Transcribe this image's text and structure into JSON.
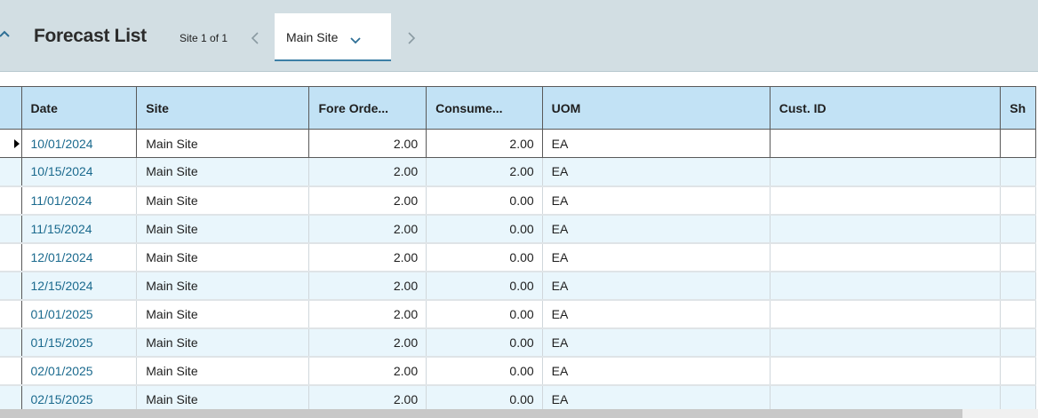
{
  "header": {
    "title": "Forecast List",
    "site_counter": "Site 1 of 1",
    "selected_site": "Main Site",
    "icons": {
      "collapse": "chevron-up-icon",
      "prev": "chevron-left-icon",
      "next": "chevron-right-icon",
      "dropdown": "chevron-down-icon"
    }
  },
  "grid": {
    "columns": [
      "Date",
      "Site",
      "Fore Orde...",
      "Consume...",
      "UOM",
      "Cust. ID",
      "Sh"
    ],
    "rows": [
      {
        "date": "10/01/2024",
        "site": "Main Site",
        "fore": "2.00",
        "consumed": "2.00",
        "uom": "EA",
        "cust": "",
        "sh": ""
      },
      {
        "date": "10/15/2024",
        "site": "Main Site",
        "fore": "2.00",
        "consumed": "2.00",
        "uom": "EA",
        "cust": "",
        "sh": ""
      },
      {
        "date": "11/01/2024",
        "site": "Main Site",
        "fore": "2.00",
        "consumed": "0.00",
        "uom": "EA",
        "cust": "",
        "sh": ""
      },
      {
        "date": "11/15/2024",
        "site": "Main Site",
        "fore": "2.00",
        "consumed": "0.00",
        "uom": "EA",
        "cust": "",
        "sh": ""
      },
      {
        "date": "12/01/2024",
        "site": "Main Site",
        "fore": "2.00",
        "consumed": "0.00",
        "uom": "EA",
        "cust": "",
        "sh": ""
      },
      {
        "date": "12/15/2024",
        "site": "Main Site",
        "fore": "2.00",
        "consumed": "0.00",
        "uom": "EA",
        "cust": "",
        "sh": ""
      },
      {
        "date": "01/01/2025",
        "site": "Main Site",
        "fore": "2.00",
        "consumed": "0.00",
        "uom": "EA",
        "cust": "",
        "sh": ""
      },
      {
        "date": "01/15/2025",
        "site": "Main Site",
        "fore": "2.00",
        "consumed": "0.00",
        "uom": "EA",
        "cust": "",
        "sh": ""
      },
      {
        "date": "02/01/2025",
        "site": "Main Site",
        "fore": "2.00",
        "consumed": "0.00",
        "uom": "EA",
        "cust": "",
        "sh": ""
      },
      {
        "date": "02/15/2025",
        "site": "Main Site",
        "fore": "2.00",
        "consumed": "0.00",
        "uom": "EA",
        "cust": "",
        "sh": ""
      }
    ]
  },
  "colors": {
    "header_bg": "#d2dee3",
    "column_header_bg": "#c2e2f5",
    "alt_row_bg": "#e9f6fc",
    "date_link": "#1b6a8e",
    "tab_underline": "#3d7fa6"
  }
}
